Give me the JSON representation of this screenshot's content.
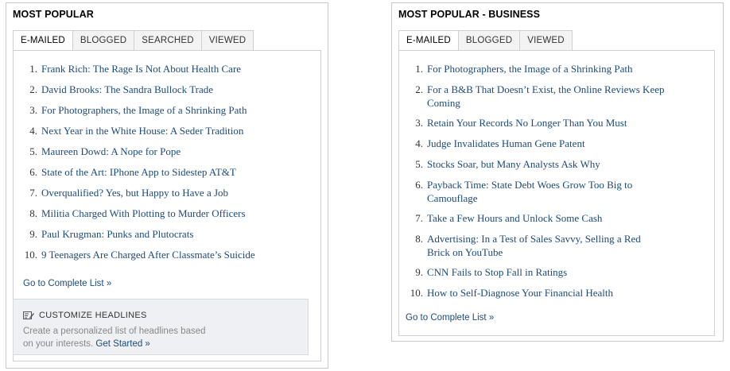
{
  "most_popular": {
    "title": "MOST POPULAR",
    "tabs": [
      "E-MAILED",
      "BLOGGED",
      "SEARCHED",
      "VIEWED"
    ],
    "active_tab": "E-MAILED",
    "items": [
      {
        "num": "1.",
        "text": "Frank Rich: The Rage Is Not About Health Care"
      },
      {
        "num": "2.",
        "text": "David Brooks: The Sandra Bullock Trade"
      },
      {
        "num": "3.",
        "text": "For Photographers, the Image of a Shrinking Path"
      },
      {
        "num": "4.",
        "text": "Next Year in the White House: A Seder Tradition"
      },
      {
        "num": "5.",
        "text": "Maureen Dowd: A Nope for Pope"
      },
      {
        "num": "6.",
        "text": "State of the Art: IPhone App to Sidestep AT&T"
      },
      {
        "num": "7.",
        "text": "Overqualified? Yes, but Happy to Have a Job"
      },
      {
        "num": "8.",
        "text": "Militia Charged With Plotting to Murder Officers"
      },
      {
        "num": "9.",
        "text": "Paul Krugman: Punks and Plutocrats"
      },
      {
        "num": "10.",
        "text": "9 Teenagers Are Charged After Classmate’s Suicide"
      }
    ],
    "complete_list_label": "Go to Complete List »",
    "customize": {
      "title": "CUSTOMIZE HEADLINES",
      "description_line1": "Create a personalized list of headlines based",
      "description_line2": "on your interests.",
      "get_started": "Get Started »"
    }
  },
  "most_popular_business": {
    "title": "MOST POPULAR - BUSINESS",
    "tabs": [
      "E-MAILED",
      "BLOGGED",
      "VIEWED"
    ],
    "active_tab": "E-MAILED",
    "items": [
      {
        "num": "1.",
        "line1": "For Photographers, the Image of a Shrinking Path",
        "line2": ""
      },
      {
        "num": "2.",
        "line1": "For a B&B That Doesn’t Exist, the Online Reviews Keep",
        "line2": "Coming"
      },
      {
        "num": "3.",
        "line1": "Retain Your Records No Longer Than You Must",
        "line2": ""
      },
      {
        "num": "4.",
        "line1": "Judge Invalidates Human Gene Patent",
        "line2": ""
      },
      {
        "num": "5.",
        "line1": "Stocks Soar, but Many Analysts Ask Why",
        "line2": ""
      },
      {
        "num": "6.",
        "line1": "Payback Time: State Debt Woes Grow Too Big to",
        "line2": "Camouflage"
      },
      {
        "num": "7.",
        "line1": "Take a Few Hours and Unlock Some Cash",
        "line2": ""
      },
      {
        "num": "8.",
        "line1": "Advertising: In a Test of Sales Savvy, Selling a Red",
        "line2": "Brick on YouTube"
      },
      {
        "num": "9.",
        "line1": "CNN Fails to Stop Fall in Ratings",
        "line2": ""
      },
      {
        "num": "10.",
        "line1": "How to Self-Diagnose Your Financial Health",
        "line2": ""
      }
    ],
    "complete_list_label": "Go to Complete List »"
  },
  "colors": {
    "link": "#1c4a7c",
    "border": "#c9c9c9",
    "customize_bg": "#eef0f3"
  },
  "icons": {
    "customize": "edit-list-icon"
  }
}
